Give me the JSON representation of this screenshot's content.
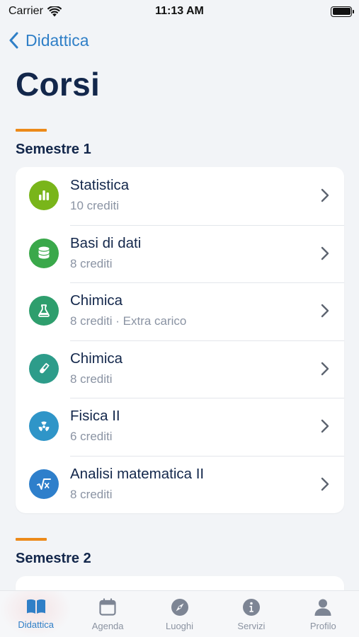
{
  "status_bar": {
    "carrier": "Carrier",
    "time": "11:13 AM"
  },
  "nav": {
    "back_label": "Didattica",
    "title": "Corsi"
  },
  "colors": {
    "accent": "#2f7fc7",
    "section_accent": "#ec8a1a"
  },
  "semesters": [
    {
      "title": "Semestre 1",
      "courses": [
        {
          "name": "Statistica",
          "details": "10 crediti",
          "icon": "bar-chart-icon",
          "icon_color": "#79b51a"
        },
        {
          "name": "Basi di dati",
          "details": "8 crediti",
          "icon": "database-icon",
          "icon_color": "#3aa84a"
        },
        {
          "name": "Chimica",
          "details": "8 crediti · Extra carico",
          "icon": "flask-icon",
          "icon_color": "#2e9e6d"
        },
        {
          "name": "Chimica",
          "details": "8 crediti",
          "icon": "test-tube-icon",
          "icon_color": "#2d9c8a"
        },
        {
          "name": "Fisica II",
          "details": "6 crediti",
          "icon": "radiation-icon",
          "icon_color": "#2f95c8"
        },
        {
          "name": "Analisi matematica II",
          "details": "8 crediti",
          "icon": "square-root-icon",
          "icon_color": "#2e7fcb"
        }
      ]
    },
    {
      "title": "Semestre 2",
      "courses": []
    }
  ],
  "tabs": [
    {
      "label": "Didattica",
      "icon": "book-icon",
      "active": true
    },
    {
      "label": "Agenda",
      "icon": "calendar-icon",
      "active": false
    },
    {
      "label": "Luoghi",
      "icon": "compass-icon",
      "active": false
    },
    {
      "label": "Servizi",
      "icon": "info-icon",
      "active": false
    },
    {
      "label": "Profilo",
      "icon": "person-icon",
      "active": false
    }
  ]
}
